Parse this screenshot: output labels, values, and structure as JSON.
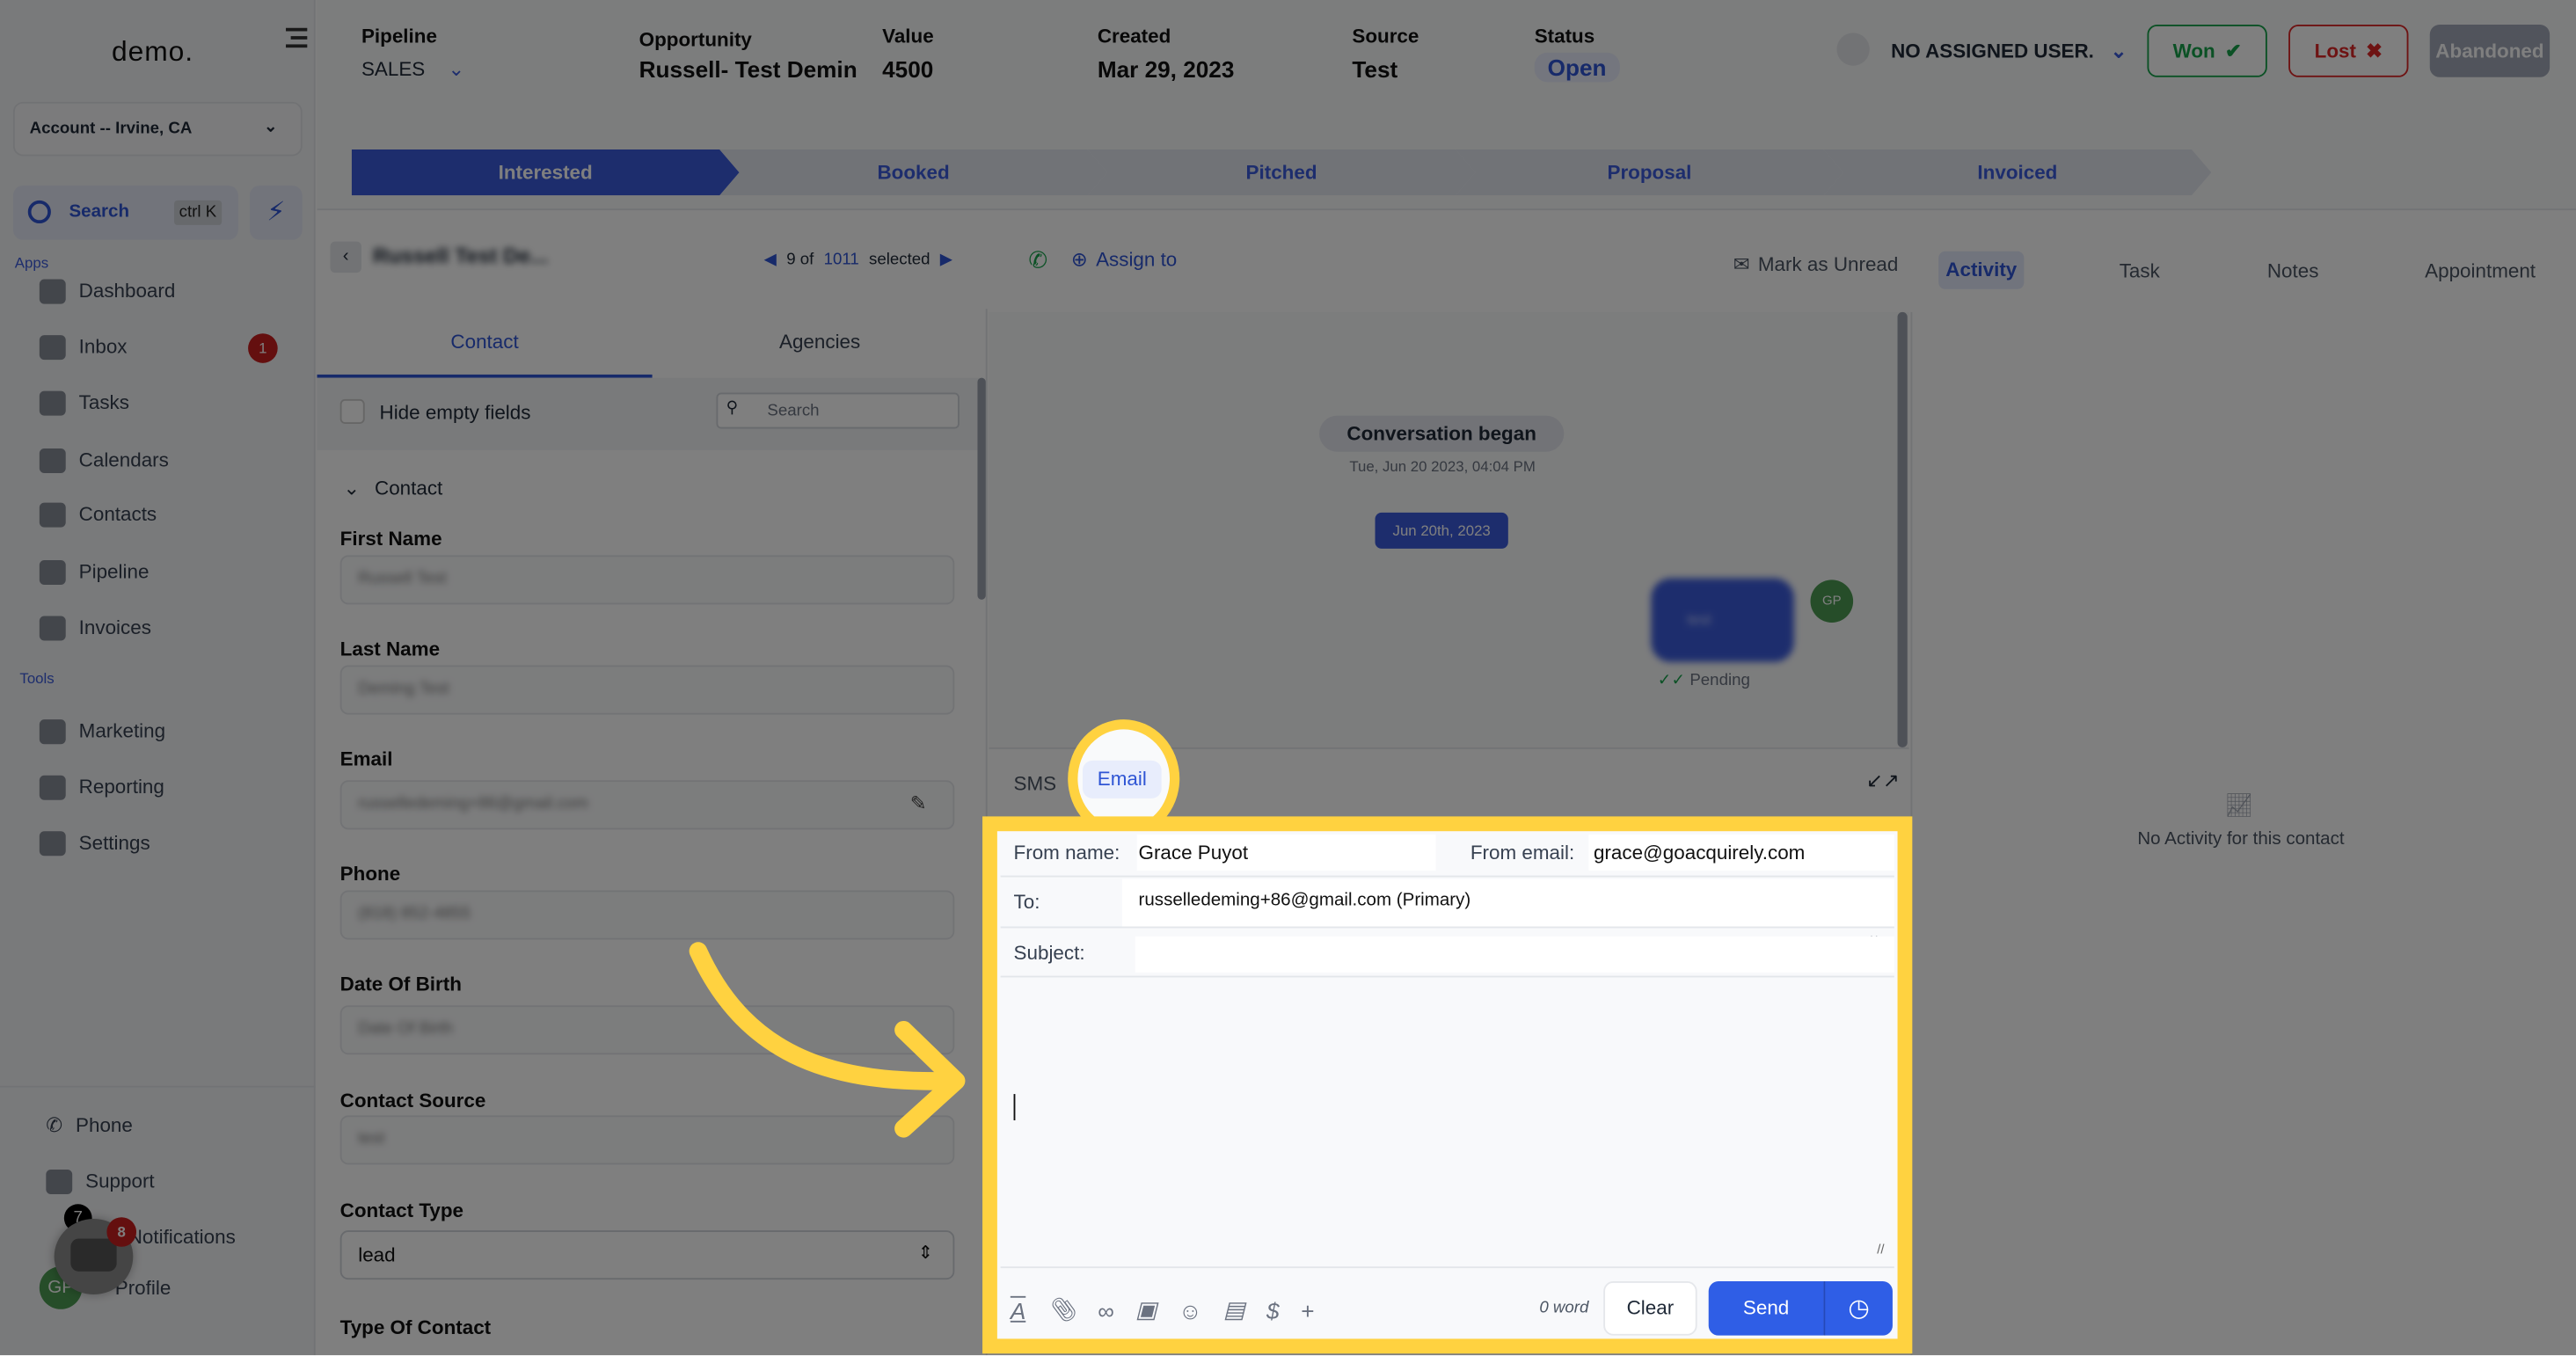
{
  "sidebar": {
    "logo": "demo.",
    "account": "Account -- Irvine, CA",
    "search_label": "Search",
    "search_shortcut": "ctrl K",
    "apps_label": "Apps",
    "tools_label": "Tools",
    "apps": [
      {
        "label": "Dashboard",
        "icon": "dashboard-icon"
      },
      {
        "label": "Inbox",
        "icon": "inbox-icon",
        "badge": "1"
      },
      {
        "label": "Tasks",
        "icon": "tasks-icon"
      },
      {
        "label": "Calendars",
        "icon": "calendar-icon"
      },
      {
        "label": "Contacts",
        "icon": "contacts-icon"
      },
      {
        "label": "Pipeline",
        "icon": "pipeline-icon"
      },
      {
        "label": "Invoices",
        "icon": "invoices-icon"
      }
    ],
    "tools": [
      {
        "label": "Marketing",
        "icon": "megaphone-icon"
      },
      {
        "label": "Reporting",
        "icon": "pie-chart-icon"
      },
      {
        "label": "Settings",
        "icon": "gear-icon"
      }
    ],
    "bottom": [
      {
        "label": "Phone"
      },
      {
        "label": "Support"
      },
      {
        "label": "Notifications",
        "badge": "7"
      },
      {
        "label": "Profile",
        "avatar": "GP"
      }
    ],
    "chat_badge": "8"
  },
  "header": {
    "pipeline_label": "Pipeline",
    "pipeline_value": "SALES",
    "opportunity_label": "Opportunity",
    "opportunity_value": "Russell- Test Demin",
    "value_label": "Value",
    "value_value": "4500",
    "created_label": "Created",
    "created_value": "Mar 29, 2023",
    "source_label": "Source",
    "source_value": "Test",
    "status_label": "Status",
    "status_value": "Open",
    "assigned_user": "NO ASSIGNED USER.",
    "won": "Won",
    "lost": "Lost",
    "abandoned": "Abandoned"
  },
  "stages": [
    "Interested",
    "Booked",
    "Pitched",
    "Proposal",
    "Invoiced"
  ],
  "toolbar": {
    "contact_name": "Russell Test De...",
    "position": "9 of",
    "total": "1011",
    "selected": "selected",
    "assign_to": "Assign to",
    "mark_unread": "Mark as Unread"
  },
  "right_tabs": [
    "Activity",
    "Task",
    "Notes",
    "Appointment"
  ],
  "right_empty": "No Activity for this contact",
  "contact_panel": {
    "tabs": [
      "Contact",
      "Agencies"
    ],
    "hide_empty": "Hide empty fields",
    "search_placeholder": "Search",
    "section": "Contact",
    "fields": [
      {
        "label": "First Name",
        "value": "Russell Test"
      },
      {
        "label": "Last Name",
        "value": "Deming Test"
      },
      {
        "label": "Email",
        "value": "russelledeming+86@gmail.com"
      },
      {
        "label": "Phone",
        "value": "(818) 852-4855"
      },
      {
        "label": "Date Of Birth",
        "value": "Date Of Birth"
      },
      {
        "label": "Contact Source",
        "value": "test"
      },
      {
        "label": "Contact Type",
        "value": "lead"
      },
      {
        "label": "Type Of Contact",
        "value": ""
      }
    ]
  },
  "conversation": {
    "began": "Conversation began",
    "began_time": "Tue, Jun 20 2023, 04:04 PM",
    "date_pill": "Jun 20th, 2023",
    "message": "test",
    "avatar": "GP",
    "status": "Pending"
  },
  "composer": {
    "tabs": [
      "SMS",
      "Email"
    ],
    "from_name_label": "From name:",
    "from_name": "Grace Puyot",
    "from_email_label": "From email:",
    "from_email": "grace@goacquirely.com",
    "to_label": "To:",
    "to_value": "russelledeming+86@gmail.com (Primary)",
    "subject_label": "Subject:",
    "word_count": "0 word",
    "clear": "Clear",
    "send": "Send"
  },
  "colors": {
    "accent": "#2f55d4",
    "highlight": "#ffd240",
    "won": "#16a34a",
    "lost": "#dc2626"
  }
}
